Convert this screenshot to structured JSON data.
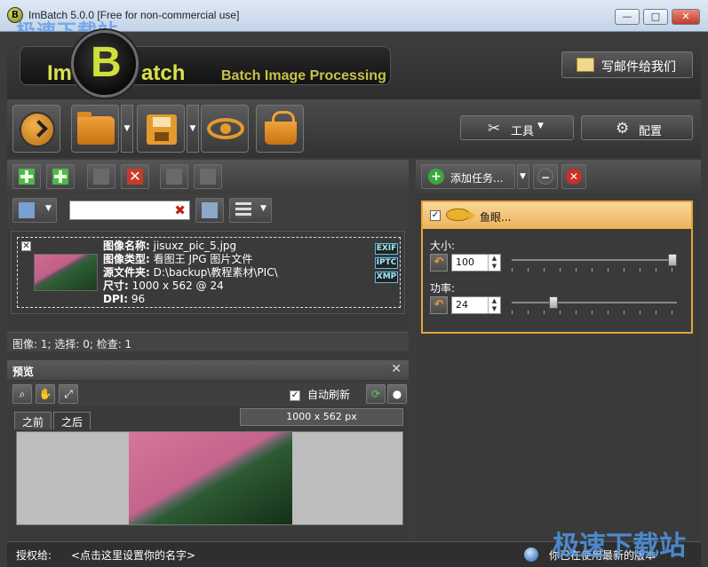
{
  "window": {
    "title": "ImBatch 5.0.0 [Free for non-commercial use]",
    "watermark_top": "极速下载站",
    "buttons": {
      "minimize": "—",
      "maximize": "□",
      "close": "✕"
    }
  },
  "header": {
    "logo_im": "Im",
    "logo_b": "B",
    "logo_atch": "atch",
    "logo_sub": "Batch Image Processing",
    "mail_label": "写邮件给我们"
  },
  "toolbar": {
    "tools_label": "工具",
    "config_label": "配置"
  },
  "left": {
    "search_value": "",
    "file": {
      "name_key": "图像名称:",
      "name_val": "jisuxz_pic_5.jpg",
      "type_key": "图像类型:",
      "type_val": "看图王 JPG 图片文件",
      "src_key": "源文件夹:",
      "src_val": "D:\\backup\\教程素材\\PIC\\",
      "size_key": "尺寸:",
      "size_val": "1000 x 562 @ 24",
      "dpi_key": "DPI:",
      "dpi_val": "96",
      "badges": [
        "EXIF",
        "IPTC",
        "XMP"
      ]
    },
    "status": "图像: 1; 选择: 0; 检查: 1",
    "preview": {
      "title": "预览",
      "auto_refresh": "自动刷新",
      "tab_before": "之前",
      "tab_after": "之后",
      "dims": "1000 x 562 px"
    }
  },
  "right": {
    "add_task": "添加任务...",
    "task_name": "鱼眼...",
    "size_label": "大小:",
    "size_value": "100",
    "size_level": 1.0,
    "power_label": "功率:",
    "power_value": "24",
    "power_level": 0.24
  },
  "bottom": {
    "license_label": "授权给:",
    "license_name": "<点击这里设置你的名字>",
    "update_status": "你已在使用最新的版本",
    "watermark": "极速下载站"
  }
}
